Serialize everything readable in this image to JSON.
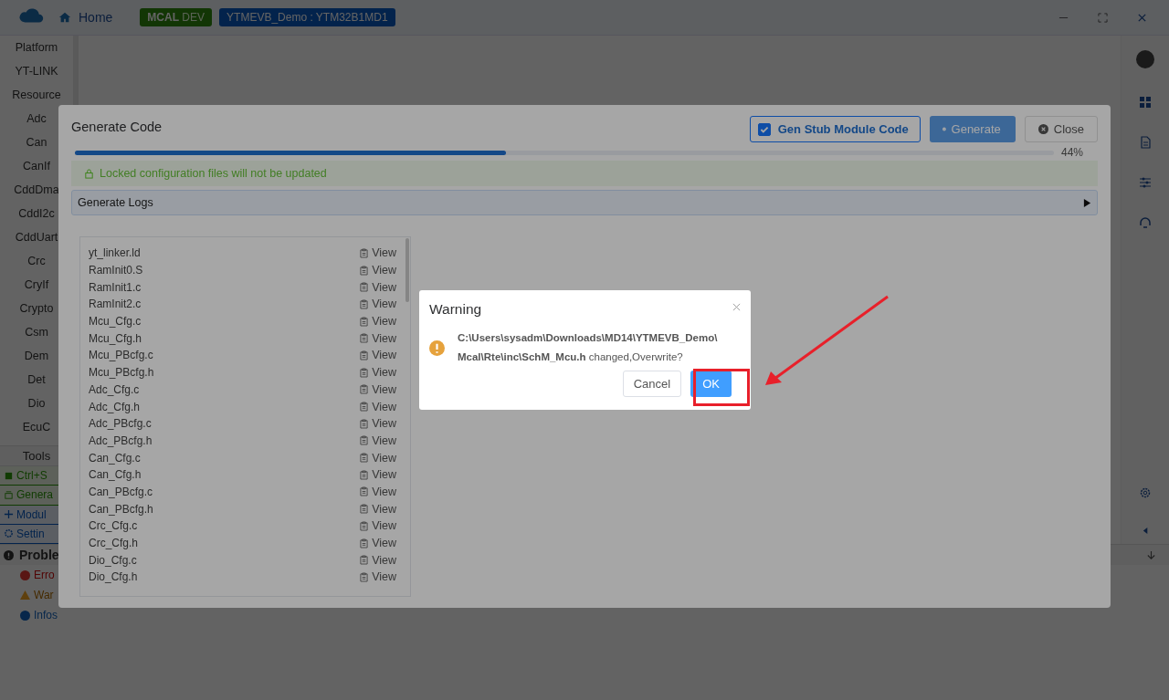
{
  "topbar": {
    "home": "Home",
    "env_tag": {
      "strong": "MCAL",
      "rest": "DEV"
    },
    "project_tag": "YTMEVB_Demo : YTM32B1MD1"
  },
  "sidebar": {
    "items": [
      "Platform",
      "YT-LINK",
      "Resource",
      "Adc",
      "Can",
      "CanIf",
      "CddDma",
      "CddI2c",
      "CddUart",
      "Crc",
      "CryIf",
      "Crypto",
      "Csm",
      "Dem",
      "Det",
      "Dio",
      "EcuC"
    ],
    "tools_title": "Tools",
    "tools": [
      {
        "kind": "save",
        "label": "Ctrl+S"
      },
      {
        "kind": "generate",
        "label": "Genera"
      },
      {
        "kind": "add",
        "label": "Modul"
      },
      {
        "kind": "settings",
        "label": "Settin"
      }
    ]
  },
  "problems": {
    "title": "Proble",
    "items": [
      {
        "kind": "error",
        "label": "Erro"
      },
      {
        "kind": "warning",
        "label": "War"
      },
      {
        "kind": "info",
        "label": "Infos"
      }
    ]
  },
  "generate_dialog": {
    "title": "Generate Code",
    "stub_checkbox": {
      "label": "Gen Stub Module Code",
      "checked": true
    },
    "generate_button": {
      "label": "Generate",
      "disabled": true
    },
    "close_button": "Close",
    "progress": {
      "level": 0.44,
      "reading": "44%"
    },
    "notice": "Locked configuration files will not be updated",
    "logs_header": {
      "label": "Generate Logs",
      "expanded": false
    },
    "files": [
      {
        "name": "yt_linker.ld",
        "action": "View"
      },
      {
        "name": "RamInit0.S",
        "action": "View"
      },
      {
        "name": "RamInit1.c",
        "action": "View"
      },
      {
        "name": "RamInit2.c",
        "action": "View"
      },
      {
        "name": "Mcu_Cfg.c",
        "action": "View"
      },
      {
        "name": "Mcu_Cfg.h",
        "action": "View"
      },
      {
        "name": "Mcu_PBcfg.c",
        "action": "View"
      },
      {
        "name": "Mcu_PBcfg.h",
        "action": "View"
      },
      {
        "name": "Adc_Cfg.c",
        "action": "View"
      },
      {
        "name": "Adc_Cfg.h",
        "action": "View"
      },
      {
        "name": "Adc_PBcfg.c",
        "action": "View"
      },
      {
        "name": "Adc_PBcfg.h",
        "action": "View"
      },
      {
        "name": "Can_Cfg.c",
        "action": "View"
      },
      {
        "name": "Can_Cfg.h",
        "action": "View"
      },
      {
        "name": "Can_PBcfg.c",
        "action": "View"
      },
      {
        "name": "Can_PBcfg.h",
        "action": "View"
      },
      {
        "name": "Crc_Cfg.c",
        "action": "View"
      },
      {
        "name": "Crc_Cfg.h",
        "action": "View"
      },
      {
        "name": "Dio_Cfg.c",
        "action": "View"
      },
      {
        "name": "Dio_Cfg.h",
        "action": "View"
      }
    ]
  },
  "warning_dialog": {
    "title": "Warning",
    "message": "**C:\\Users\\sysadm\\Downloads\\MD14\\YTMEVB_Demo\\ Mcal\\Rte\\inc\\SchM_Mcu.h** changed,Overwrite?",
    "cancel": "Cancel",
    "ok": "OK"
  }
}
